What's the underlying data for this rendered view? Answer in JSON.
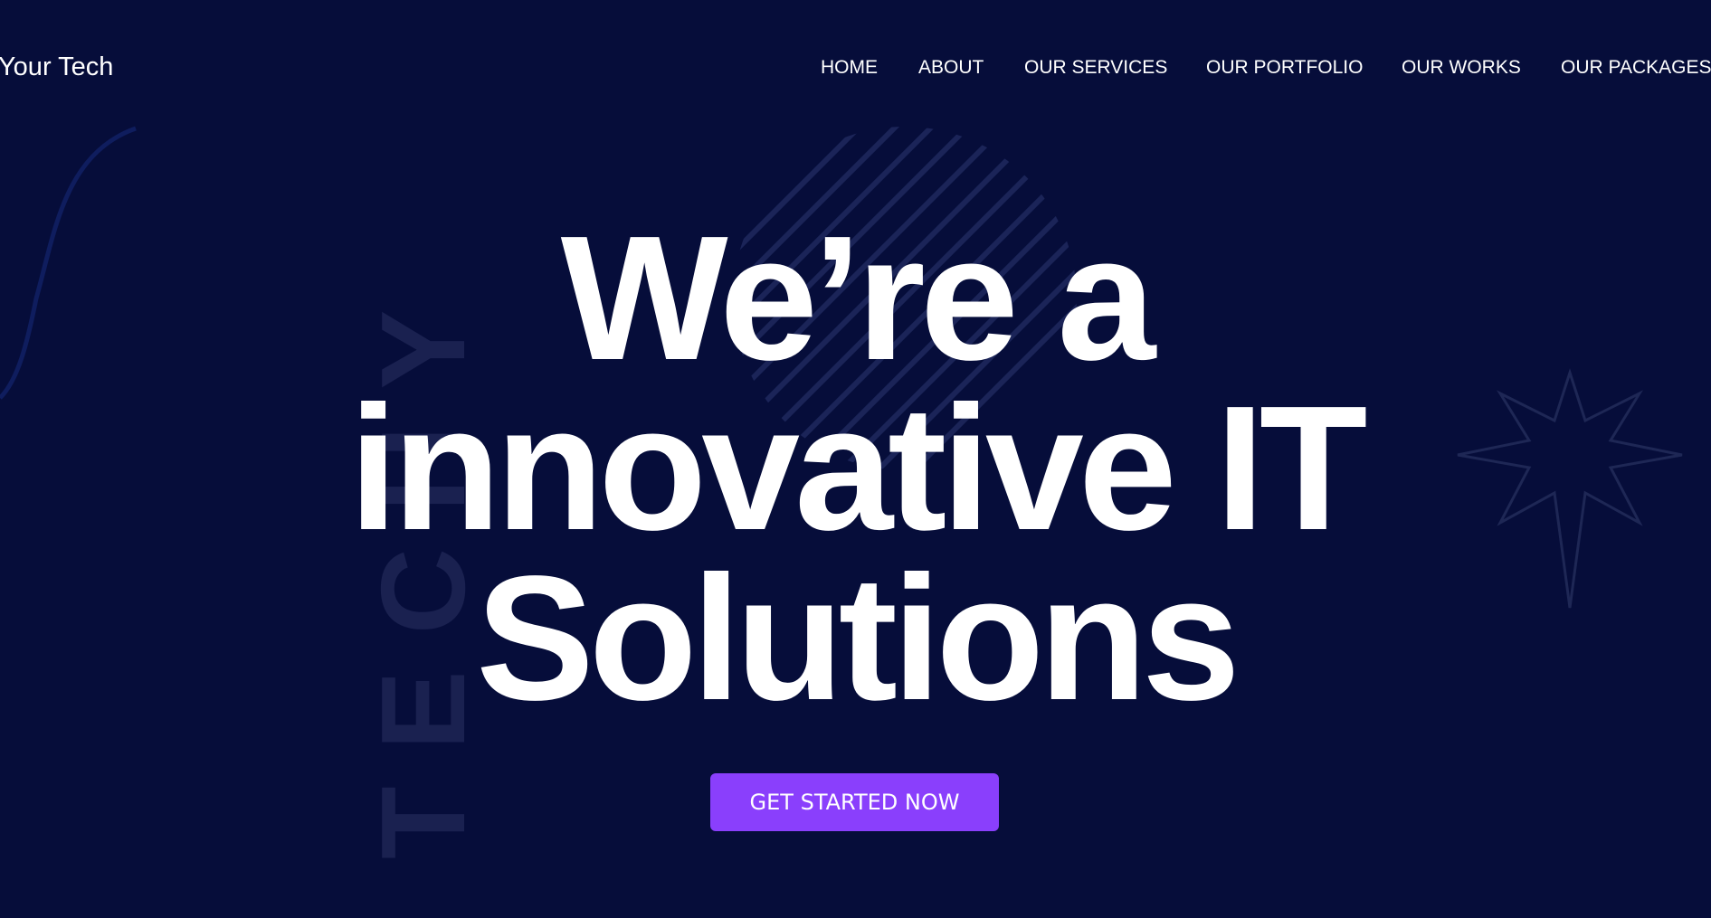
{
  "header": {
    "brand": "Your Tech",
    "nav": [
      {
        "label": "HOME"
      },
      {
        "label": "ABOUT"
      },
      {
        "label": "OUR SERVICES"
      },
      {
        "label": "OUR PORTFOLIO"
      },
      {
        "label": "OUR WORKS"
      },
      {
        "label": "OUR PACKAGES"
      }
    ]
  },
  "hero": {
    "watermark": "TECHY",
    "title_lines": [
      "We’re a",
      "innovative IT",
      "Solutions"
    ],
    "cta_label": "GET STARTED NOW"
  },
  "colors": {
    "background": "#060d3a",
    "accent": "#8a3ffc",
    "text": "#ffffff",
    "decoration": "#1a2150"
  },
  "icons": [
    "starburst-decoration",
    "striped-circle-decoration",
    "wave-line-decoration"
  ]
}
